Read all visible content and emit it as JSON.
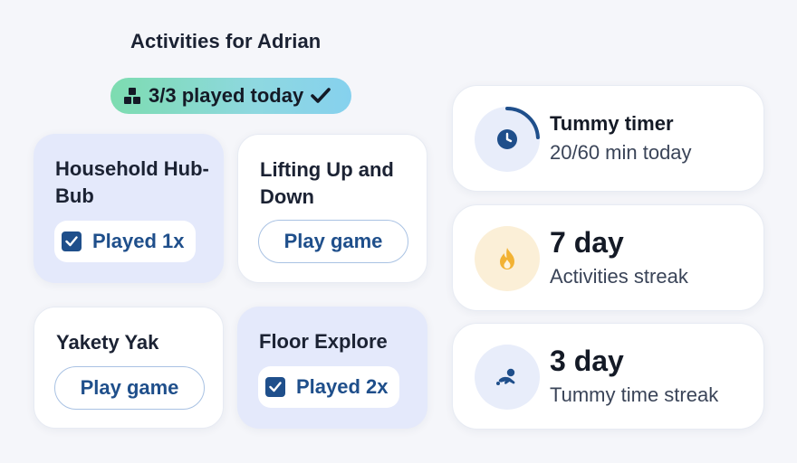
{
  "header": {
    "title": "Activities for Adrian",
    "summary": "3/3 played today"
  },
  "activities": [
    {
      "name": "Household Hub-Bub",
      "state": "played",
      "label": "Played 1x"
    },
    {
      "name": "Lifting Up and Down",
      "state": "unplayed",
      "label": "Play game"
    },
    {
      "name": "Yakety Yak",
      "state": "unplayed",
      "label": "Play game"
    },
    {
      "name": "Floor Explore",
      "state": "played",
      "label": "Played 2x"
    }
  ],
  "stats": {
    "tummy_timer": {
      "title": "Tummy timer",
      "detail": "20/60 min today",
      "minutes_done": 20,
      "minutes_goal": 60,
      "icon": "clock-icon"
    },
    "activities_streak": {
      "value": "7 day",
      "label": "Activities streak",
      "icon": "flame-icon"
    },
    "tummy_streak": {
      "value": "3 day",
      "label": "Tummy time streak",
      "icon": "baby-crawl-icon"
    }
  },
  "colors": {
    "brand_blue": "#1f4f8b",
    "played_card": "#e4e9fb",
    "pill_start": "#7ddcb0",
    "pill_end": "#86d1ee",
    "flame": "#f2b233"
  }
}
